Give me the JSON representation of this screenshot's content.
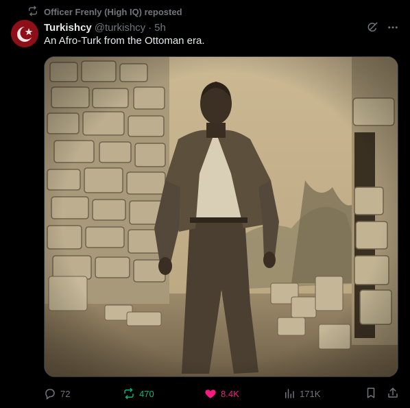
{
  "repost": {
    "icon": "repost-icon",
    "label": "Officer Frenly (High IQ) reposted"
  },
  "tweet": {
    "display_name": "Turkishcy",
    "handle": "@turkishcy",
    "separator": "·",
    "time": "5h",
    "text": "An Afro-Turk from the Ottoman era."
  },
  "header_icons": [
    "grok-icon",
    "more-icon"
  ],
  "actions": {
    "reply_count": "72",
    "repost_count": "470",
    "like_count": "8.4K",
    "views_count": "171K"
  },
  "colors": {
    "background": "#000000",
    "text": "#e7e9ea",
    "muted": "#71767b",
    "repost_active": "#00ba7c",
    "like_active": "#f91880"
  }
}
